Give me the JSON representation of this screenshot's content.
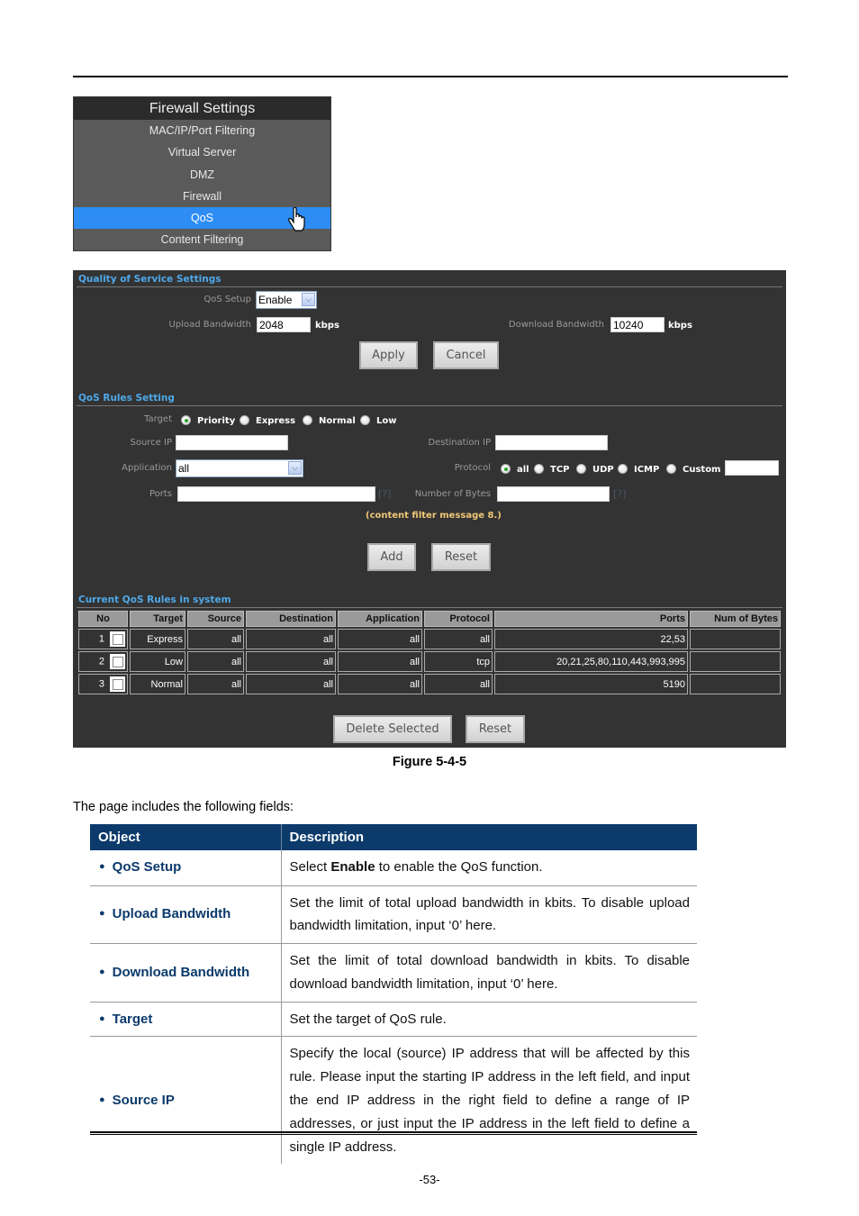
{
  "menu": {
    "title": "Firewall Settings",
    "items": [
      {
        "label": "MAC/IP/Port Filtering",
        "active": false
      },
      {
        "label": "Virtual Server",
        "active": false
      },
      {
        "label": "DMZ",
        "active": false
      },
      {
        "label": "Firewall",
        "active": false
      },
      {
        "label": "QoS",
        "active": true
      },
      {
        "label": "Content Filtering",
        "active": false
      }
    ],
    "cursor_icon": "hand-pointer-icon"
  },
  "qos_settings": {
    "section_title": "Quality of Service Settings",
    "qos_setup_label": "QoS Setup",
    "qos_setup_value": "Enable",
    "upload_label": "Upload Bandwidth",
    "upload_value": "2048",
    "upload_unit": "kbps",
    "download_label": "Download Bandwidth",
    "download_value": "10240",
    "download_unit": "kbps",
    "apply_label": "Apply",
    "cancel_label": "Cancel"
  },
  "rules_setting": {
    "section_title": "QoS Rules Setting",
    "target_label": "Target",
    "target_options": [
      "Priority",
      "Express",
      "Normal",
      "Low"
    ],
    "target_selected": "Priority",
    "source_ip_label": "Source IP",
    "source_ip_value": "",
    "destination_ip_label": "Destination IP",
    "destination_ip_value": "",
    "application_label": "Application",
    "application_value": "all",
    "protocol_label": "Protocol",
    "protocol_options": [
      "all",
      "TCP",
      "UDP",
      "ICMP",
      "Custom"
    ],
    "protocol_selected": "all",
    "custom_value": "",
    "ports_label": "Ports",
    "ports_value": "",
    "bytes_label": "Number of Bytes",
    "bytes_value": "",
    "help_label": "[?]",
    "message": "(content filter message 8.)",
    "add_label": "Add",
    "reset_label": "Reset"
  },
  "current_rules": {
    "section_title": "Current QoS Rules in system",
    "columns": [
      "No",
      "Target",
      "Source",
      "Destination",
      "Application",
      "Protocol",
      "Ports",
      "Num of Bytes"
    ],
    "rows": [
      {
        "no": "1",
        "target": "Express",
        "source": "all",
        "destination": "all",
        "application": "all",
        "protocol": "all",
        "ports": "22,53",
        "bytes": ""
      },
      {
        "no": "2",
        "target": "Low",
        "source": "all",
        "destination": "all",
        "application": "all",
        "protocol": "tcp",
        "ports": "20,21,25,80,110,443,993,995",
        "bytes": ""
      },
      {
        "no": "3",
        "target": "Normal",
        "source": "all",
        "destination": "all",
        "application": "all",
        "protocol": "all",
        "ports": "5190",
        "bytes": ""
      }
    ],
    "delete_label": "Delete Selected",
    "reset_label": "Reset"
  },
  "caption": "Figure 5-4-5",
  "intro": "The page includes the following fields:",
  "fields_table": {
    "header_object": "Object",
    "header_description": "Description",
    "rows": [
      {
        "object": "QoS Setup",
        "desc_pre": "Select ",
        "desc_bold": "Enable",
        "desc_post": " to enable the QoS function."
      },
      {
        "object": "Upload Bandwidth",
        "desc_pre": "Set the limit of total upload bandwidth in kbits. To disable upload bandwidth limitation, input ‘0’ here.",
        "desc_bold": "",
        "desc_post": ""
      },
      {
        "object": "Download Bandwidth",
        "desc_pre": "Set the limit of total download bandwidth in kbits. To disable download bandwidth limitation, input ‘0’ here.",
        "desc_bold": "",
        "desc_post": ""
      },
      {
        "object": "Target",
        "desc_pre": "Set the target of QoS rule.",
        "desc_bold": "",
        "desc_post": ""
      },
      {
        "object": "Source IP",
        "desc_pre": "Specify the local (source) IP address that will be affected by this rule. Please input the starting IP address in the left field, and input the end IP address in the right field to define a range of IP addresses, or just input the IP address in the left field to define a single IP address.",
        "desc_bold": "",
        "desc_post": ""
      }
    ]
  },
  "page_number": "-53-",
  "colors": {
    "menu_active": "#2e8df5",
    "panel_bg": "#333333",
    "section_title": "#4fa8e8",
    "message": "#f0c878",
    "table_header": "#0b3a6b"
  }
}
